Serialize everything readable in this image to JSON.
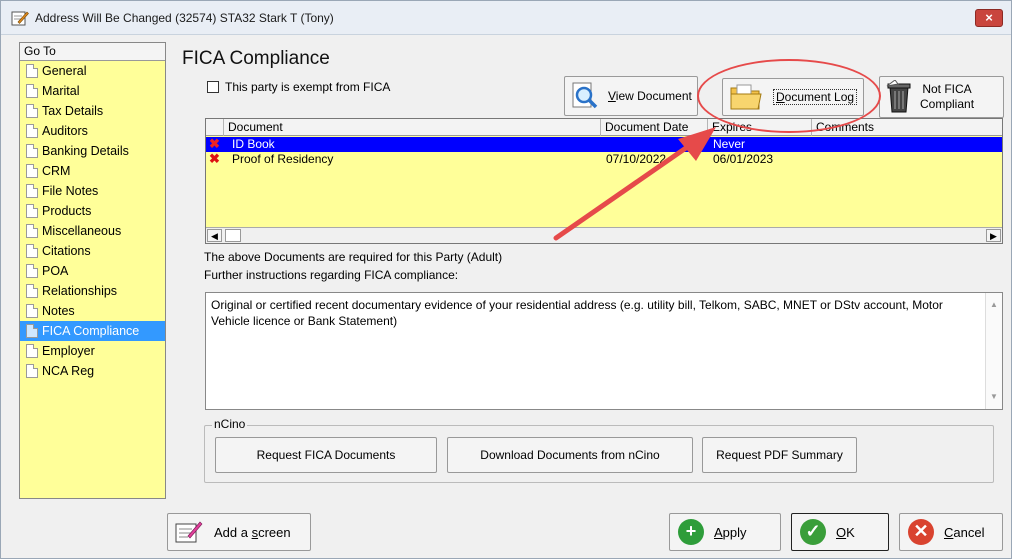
{
  "window": {
    "title": "Address Will Be Changed (32574) STA32 Stark T (Tony)",
    "close_label": "×"
  },
  "goto": {
    "header": "Go To",
    "items": [
      {
        "label": "General"
      },
      {
        "label": "Marital"
      },
      {
        "label": "Tax Details"
      },
      {
        "label": "Auditors"
      },
      {
        "label": "Banking Details"
      },
      {
        "label": "CRM"
      },
      {
        "label": "File Notes"
      },
      {
        "label": "Products"
      },
      {
        "label": "Miscellaneous"
      },
      {
        "label": "Citations"
      },
      {
        "label": "POA"
      },
      {
        "label": "Relationships"
      },
      {
        "label": "Notes"
      },
      {
        "label": "FICA Compliance"
      },
      {
        "label": "Employer"
      },
      {
        "label": "NCA Reg"
      }
    ],
    "active_index": 13
  },
  "fica": {
    "title": "FICA Compliance",
    "exempt_label": "This party is exempt from FICA",
    "view_document_u": "V",
    "view_document_rest": "iew Document",
    "document_log_u": "D",
    "document_log_rest": "ocument Log",
    "not_fica_line1": "Not FICA",
    "not_fica_line2": "Compliant",
    "columns": [
      "Document",
      "Document Date",
      "Expires",
      "Comments"
    ],
    "rows": [
      {
        "document": "ID Book",
        "date": "",
        "expires": "Never",
        "comments": ""
      },
      {
        "document": "Proof of Residency",
        "date": "07/10/2022",
        "expires": "06/01/2023",
        "comments": ""
      }
    ],
    "required_note": "The above Documents are required for this Party (Adult)",
    "further_label": "Further instructions regarding FICA compliance:",
    "instructions": "Original or certified recent documentary evidence of your residential address (e.g. utility bill, Telkom, SABC, MNET or DStv account, Motor Vehicle licence or Bank Statement)"
  },
  "ncino": {
    "group_label": "nCino",
    "request_fica": "Request FICA Documents",
    "download": "Download Documents from nCino",
    "request_pdf": "Request PDF Summary"
  },
  "footer": {
    "add_screen_pre": "Add a ",
    "add_screen_u": "s",
    "add_screen_post": "creen",
    "apply_u": "A",
    "apply_rest": "pply",
    "ok_u": "O",
    "ok_rest": "K",
    "cancel_u": "C",
    "cancel_rest": "ancel"
  },
  "colors": {
    "goto_bg": "#ffff99",
    "selection": "#0000ff",
    "active_nav": "#3399ff",
    "annotation": "#e64a4a"
  }
}
